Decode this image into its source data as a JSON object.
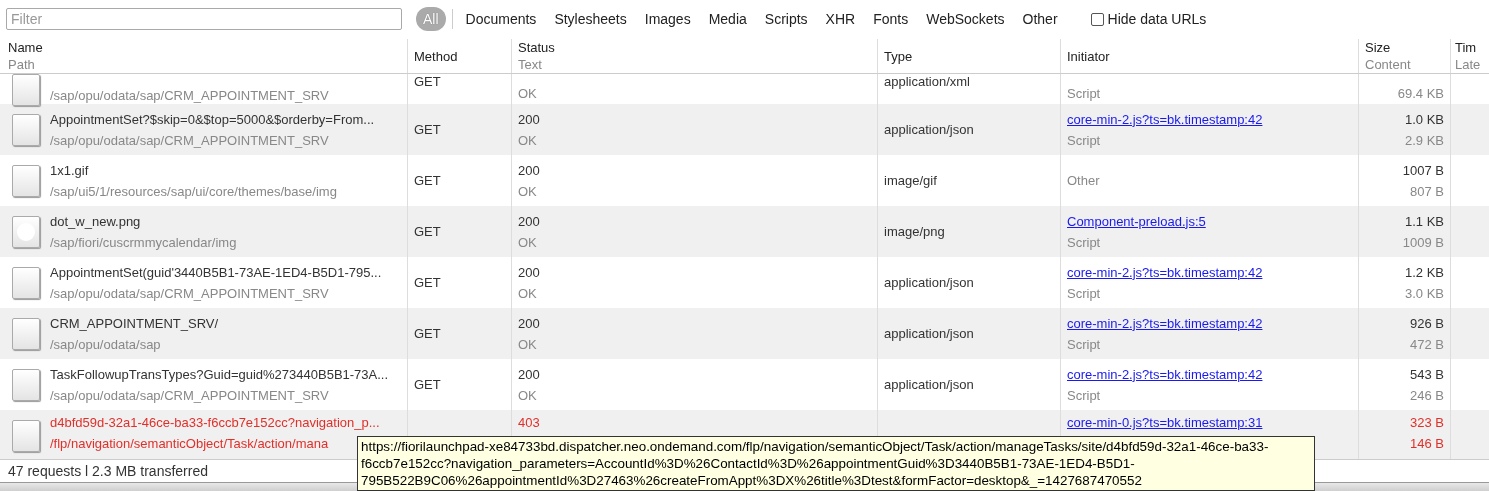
{
  "toolbar": {
    "filter": {
      "placeholder": "Filter"
    },
    "type_filters": [
      {
        "label": "All",
        "selected": true
      },
      {
        "label": "Documents",
        "selected": false
      },
      {
        "label": "Stylesheets",
        "selected": false
      },
      {
        "label": "Images",
        "selected": false
      },
      {
        "label": "Media",
        "selected": false
      },
      {
        "label": "Scripts",
        "selected": false
      },
      {
        "label": "XHR",
        "selected": false
      },
      {
        "label": "Fonts",
        "selected": false
      },
      {
        "label": "WebSockets",
        "selected": false
      },
      {
        "label": "Other",
        "selected": false
      }
    ],
    "hide_data_urls": {
      "label": "Hide data URLs",
      "checked": false
    }
  },
  "table": {
    "columns": [
      {
        "title": "Name",
        "subtitle": "Path"
      },
      {
        "title": "Method"
      },
      {
        "title": "Status",
        "subtitle": "Text"
      },
      {
        "title": "Type"
      },
      {
        "title": "Initiator"
      },
      {
        "title": "Size",
        "subtitle": "Content"
      },
      {
        "title": "Tim",
        "subtitle": "Late"
      }
    ],
    "rows": [
      {
        "kind": "file",
        "cut": true,
        "failed": false,
        "path": "/sap/opu/odata/sap/CRM_APPOINTMENT_SRV",
        "method": "GET",
        "status_text": "OK",
        "type": "application/xml",
        "initiator_type": "Script",
        "content": "69.4 KB"
      },
      {
        "kind": "file",
        "cut": false,
        "failed": false,
        "name": "AppointmentSet?$skip=0&$top=5000&$orderby=From...",
        "path": "/sap/opu/odata/sap/CRM_APPOINTMENT_SRV",
        "method": "GET",
        "status": "200",
        "status_text": "OK",
        "type": "application/json",
        "initiator": "core-min-2.js?ts=bk.timestamp:42",
        "initiator_type": "Script",
        "size": "1.0 KB",
        "content": "2.9 KB"
      },
      {
        "kind": "file",
        "cut": false,
        "failed": false,
        "name": "1x1.gif",
        "path": "/sap/ui5/1/resources/sap/ui/core/themes/base/img",
        "method": "GET",
        "status": "200",
        "status_text": "OK",
        "type": "image/gif",
        "initiator_type": "Other",
        "size": "1007 B",
        "content": "807 B"
      },
      {
        "kind": "image",
        "cut": false,
        "failed": false,
        "name": "dot_w_new.png",
        "path": "/sap/fiori/cuscrmmycalendar/img",
        "method": "GET",
        "status": "200",
        "status_text": "OK",
        "type": "image/png",
        "initiator": "Component-preload.js:5",
        "initiator_type": "Script",
        "size": "1.1 KB",
        "content": "1009 B"
      },
      {
        "kind": "file",
        "cut": false,
        "failed": false,
        "name": "AppointmentSet(guid'3440B5B1-73AE-1ED4-B5D1-795...",
        "path": "/sap/opu/odata/sap/CRM_APPOINTMENT_SRV",
        "method": "GET",
        "status": "200",
        "status_text": "OK",
        "type": "application/json",
        "initiator": "core-min-2.js?ts=bk.timestamp:42",
        "initiator_type": "Script",
        "size": "1.2 KB",
        "content": "3.0 KB"
      },
      {
        "kind": "file",
        "cut": false,
        "failed": false,
        "name": "CRM_APPOINTMENT_SRV/",
        "path": "/sap/opu/odata/sap",
        "method": "GET",
        "status": "200",
        "status_text": "OK",
        "type": "application/json",
        "initiator": "core-min-2.js?ts=bk.timestamp:42",
        "initiator_type": "Script",
        "size": "926 B",
        "content": "472 B"
      },
      {
        "kind": "file",
        "cut": false,
        "failed": false,
        "name": "TaskFollowupTransTypes?Guid=guid%273440B5B1-73A...",
        "path": "/sap/opu/odata/sap/CRM_APPOINTMENT_SRV",
        "method": "GET",
        "status": "200",
        "status_text": "OK",
        "type": "application/json",
        "initiator": "core-min-2.js?ts=bk.timestamp:42",
        "initiator_type": "Script",
        "size": "543 B",
        "content": "246 B"
      },
      {
        "kind": "file",
        "cut": false,
        "failed": true,
        "name": "d4bfd59d-32a1-46ce-ba33-f6ccb7e152cc?navigation_p...",
        "path": "/flp/navigation/semanticObject/Task/action/mana",
        "status": "403",
        "initiator": "core-min-0.js?ts=bk.timestamp:31",
        "size": "323 B",
        "content": "146 B"
      }
    ]
  },
  "tooltip": {
    "lines": [
      "https://fiorilaunchpad-xe84733bd.dispatcher.neo.ondemand.com/flp/navigation/semanticObject/Task/action/manageTasks/site/d4bfd59d-32a1-46ce-ba33-",
      "f6ccb7e152cc?navigation_parameters=AccountId%3D%26ContactId%3D%26appointmentGuid%3D3440B5B1-73AE-1ED4-B5D1-",
      "795B522B9C06%26appointmentId%3D27463%26createFromAppt%3DX%26title%3Dtest&formFactor=desktop&_=1427687470552"
    ]
  },
  "status_bar": {
    "summary": "47 requests l 2.3 MB transferred"
  }
}
